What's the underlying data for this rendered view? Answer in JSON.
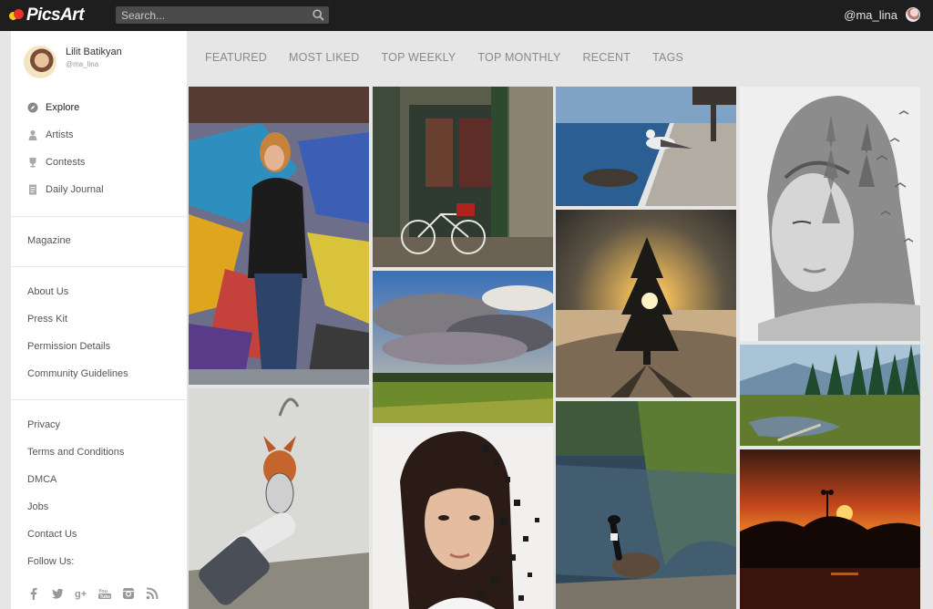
{
  "header": {
    "logo_text": "PicsArt",
    "search_placeholder": "Search...",
    "username": "@ma_lina"
  },
  "profile": {
    "name": "Lilit Batikyan",
    "handle": "@ma_lina"
  },
  "nav": [
    {
      "label": "Explore",
      "icon": "compass-icon",
      "active": true
    },
    {
      "label": "Artists",
      "icon": "person-icon"
    },
    {
      "label": "Contests",
      "icon": "trophy-icon"
    },
    {
      "label": "Daily Journal",
      "icon": "journal-icon"
    }
  ],
  "links": {
    "magazine": "Magazine",
    "about": "About Us",
    "press": "Press Kit",
    "permission": "Permission Details",
    "guidelines": "Community Guidelines",
    "privacy": "Privacy",
    "terms": "Terms and Conditions",
    "dmca": "DMCA",
    "jobs": "Jobs",
    "contact": "Contact Us",
    "follow": "Follow Us:"
  },
  "social": [
    "facebook-icon",
    "twitter-icon",
    "google-plus-icon",
    "youtube-icon",
    "instagram-icon",
    "rss-icon"
  ],
  "tabs": [
    "FEATURED",
    "MOST LIKED",
    "TOP WEEKLY",
    "TOP MONTHLY",
    "RECENT",
    "TAGS"
  ],
  "photos": [
    "girl-graffiti-photo",
    "bicycle-shopfront-photo",
    "seagull-pier-photo",
    "double-exposure-portrait-photo",
    "cloudy-sky-field-photo",
    "sunset-tree-snow-photo",
    "forest-pond-photo",
    "fox-street-art-photo",
    "pixel-dispersion-portrait-photo",
    "goose-lake-photo",
    "orange-sunset-photo"
  ]
}
